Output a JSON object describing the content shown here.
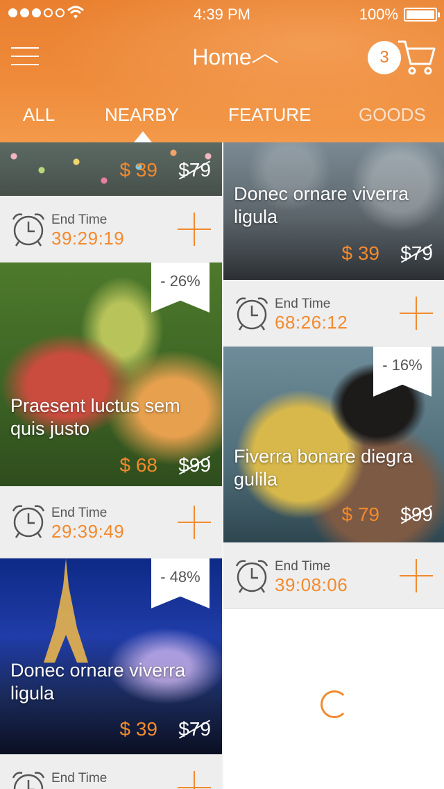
{
  "status_bar": {
    "time": "4:39 PM",
    "battery": "100%"
  },
  "header": {
    "title": "Home",
    "cart_count": "3"
  },
  "tabs": [
    {
      "label": "ALL"
    },
    {
      "label": "NEARBY"
    },
    {
      "label": "FEATURE"
    },
    {
      "label": "GOODS"
    }
  ],
  "active_tab": "NEARBY",
  "end_time_label": "End Time",
  "left_column": [
    {
      "price": "$ 39",
      "old_price": "$79",
      "end_time": "39:29:19"
    },
    {
      "title": "Praesent luctus sem quis justo",
      "discount": "- 26%",
      "price": "$ 68",
      "old_price": "$99",
      "end_time": "29:39:49"
    },
    {
      "title": "Donec ornare viverra ligula",
      "discount": "- 48%",
      "price": "$ 39",
      "old_price": "$79"
    }
  ],
  "right_column": [
    {
      "title": "Donec ornare viverra ligula",
      "price": "$ 39",
      "old_price": "$79",
      "end_time": "68:26:12"
    },
    {
      "title": "Fiverra bonare diegra gulila",
      "discount": "- 16%",
      "price": "$ 79",
      "old_price": "$99",
      "end_time": "39:08:06"
    }
  ],
  "colors": {
    "accent": "#f28a2e",
    "header": "#ee8a3a"
  }
}
